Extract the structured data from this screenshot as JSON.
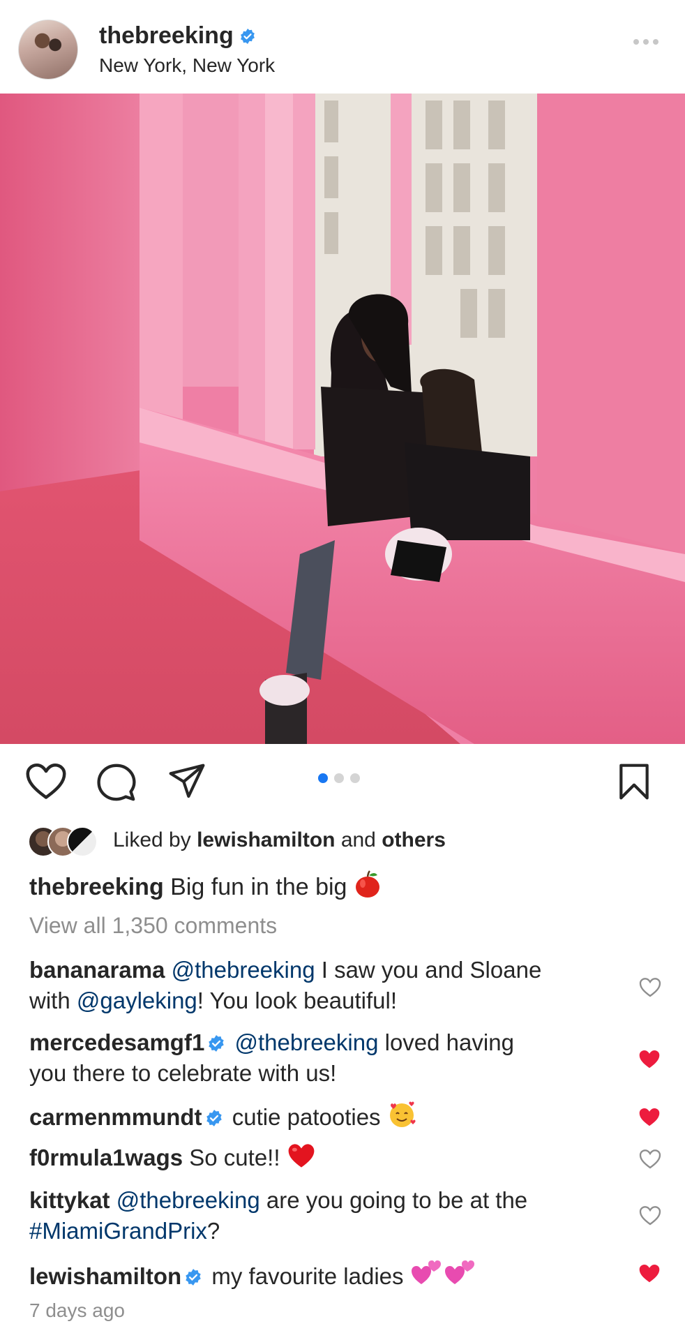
{
  "post": {
    "username": "thebreeking",
    "location": "New York, New York",
    "verified": true
  },
  "carousel": {
    "count": 3,
    "active": 1
  },
  "likes": {
    "prefix": "Liked by",
    "user": "lewishamilton",
    "conj": "and",
    "rest": "others"
  },
  "caption": {
    "username": "thebreeking",
    "text": "Big fun in the big",
    "emoji": "apple"
  },
  "view_all": "View all 1,350 comments",
  "comments": [
    {
      "user": "bananarama",
      "verified": false,
      "parts": [
        {
          "t": "@thebreeking",
          "m": true
        },
        {
          "t": " I saw you and Sloane",
          "m": false
        }
      ],
      "line2": [
        {
          "t": "with ",
          "m": false
        },
        {
          "t": "@gayleking",
          "m": true
        },
        {
          "t": "! You look beautiful!",
          "m": false
        }
      ],
      "liked": false
    },
    {
      "user": "mercedesamgf1",
      "verified": true,
      "parts": [
        {
          "t": "@thebreeking",
          "m": true
        },
        {
          "t": " loved having",
          "m": false
        }
      ],
      "line2": [
        {
          "t": "you there to celebrate with us!",
          "m": false
        }
      ],
      "liked": true
    },
    {
      "user": "carmenmmundt",
      "verified": true,
      "parts": [
        {
          "t": "cutie patooties",
          "m": false
        }
      ],
      "emoji": "smiling-hearts",
      "liked": true
    },
    {
      "user": "f0rmula1wags",
      "verified": false,
      "parts": [
        {
          "t": "So cute!!",
          "m": false
        }
      ],
      "emoji": "red-heart",
      "liked": false
    },
    {
      "user": "kittykat",
      "verified": false,
      "parts": [
        {
          "t": "@thebreeking",
          "m": true
        },
        {
          "t": " are you going to be at the",
          "m": false
        }
      ],
      "line2": [
        {
          "t": "#MiamiGrandPrix",
          "m": true
        },
        {
          "t": "?",
          "m": false
        }
      ],
      "liked": false
    },
    {
      "user": "lewishamilton",
      "verified": true,
      "parts": [
        {
          "t": "my favourite ladies",
          "m": false
        }
      ],
      "emoji": "two-hearts",
      "liked": true
    }
  ],
  "time_ago": "7 days ago",
  "colors": {
    "verified": "#3897f0",
    "heart_liked": "#ed1c3e",
    "mention": "#00376b",
    "dot_active": "#1877f2"
  }
}
